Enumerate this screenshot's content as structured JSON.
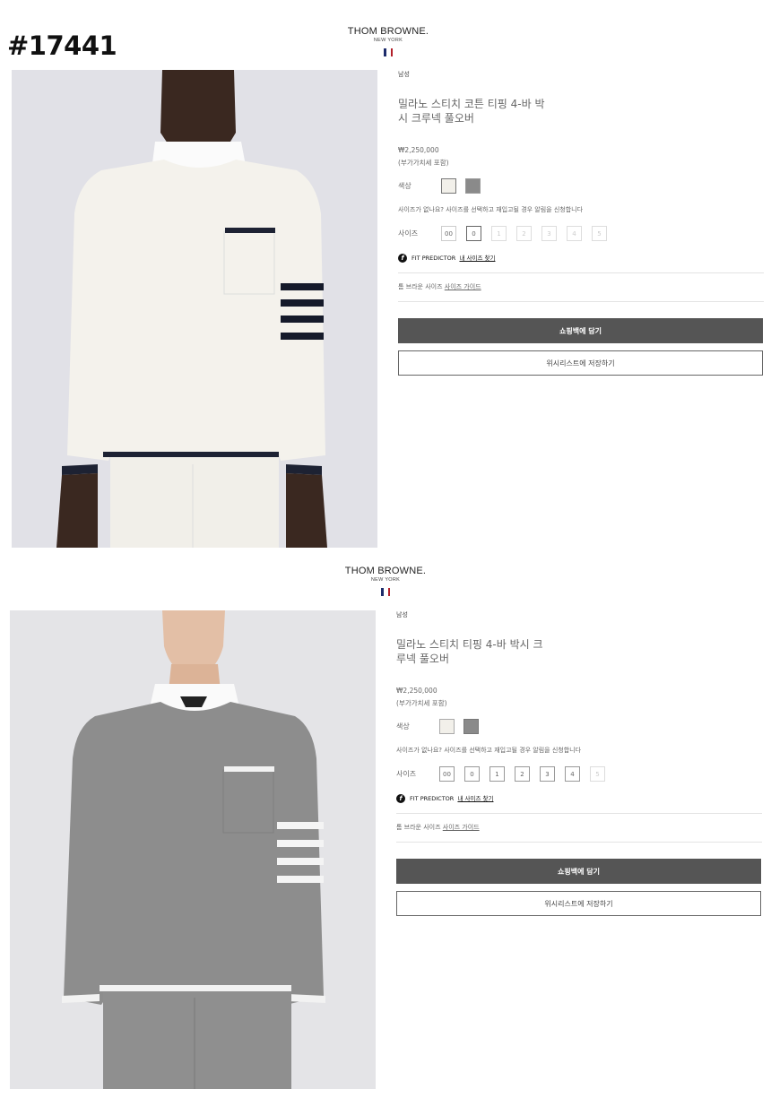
{
  "watermark": "#17441",
  "products": [
    {
      "logo": {
        "brand": "THOM BROWNE.",
        "city": "NEW YORK"
      },
      "category": "남성",
      "title": "밀라노 스티치 코튼 티핑 4-바 박시 크루넥 풀오버",
      "price": "₩2,250,000",
      "vat_note": "(부가가치세 포함)",
      "color_label": "색상",
      "colors": [
        "#f2f0ea",
        "#8a8a8a"
      ],
      "size_note": "사이즈가 없나요? 사이즈를 선택하고 재입고될 경우 알림을 신청합니다",
      "size_label": "사이즈",
      "sizes": [
        "00",
        "0",
        "1",
        "2",
        "3",
        "4",
        "5"
      ],
      "selected_size": "0",
      "fit_predictor": "FIT PREDICTOR",
      "fit_link": "내 사이즈 찾기",
      "size_guide_prefix": "톰 브라운 사이즈",
      "size_guide_link": "사이즈 가이드",
      "add_to_bag": "쇼핑백에 담기",
      "wishlist": "위시리스트에 저장하기",
      "garment_color": "#f4f2ec"
    },
    {
      "logo": {
        "brand": "THOM BROWNE.",
        "city": "NEW YORK"
      },
      "category": "남성",
      "title": "밀라노 스티치 티핑 4-바 박시 크루넥 풀오버",
      "price": "₩2,250,000",
      "vat_note": "(부가가치세 포함)",
      "color_label": "색상",
      "colors": [
        "#f2f0ea",
        "#8a8a8a"
      ],
      "size_note": "사이즈가 없나요? 사이즈를 선택하고 재입고될 경우 알림을 신청합니다",
      "size_label": "사이즈",
      "sizes": [
        "00",
        "0",
        "1",
        "2",
        "3",
        "4",
        "5"
      ],
      "selected_size": "",
      "fit_predictor": "FIT PREDICTOR",
      "fit_link": "내 사이즈 찾기",
      "size_guide_prefix": "톰 브라운 사이즈",
      "size_guide_link": "사이즈 가이드",
      "add_to_bag": "쇼핑백에 담기",
      "wishlist": "위시리스트에 저장하기",
      "garment_color": "#8d8d8d"
    }
  ]
}
